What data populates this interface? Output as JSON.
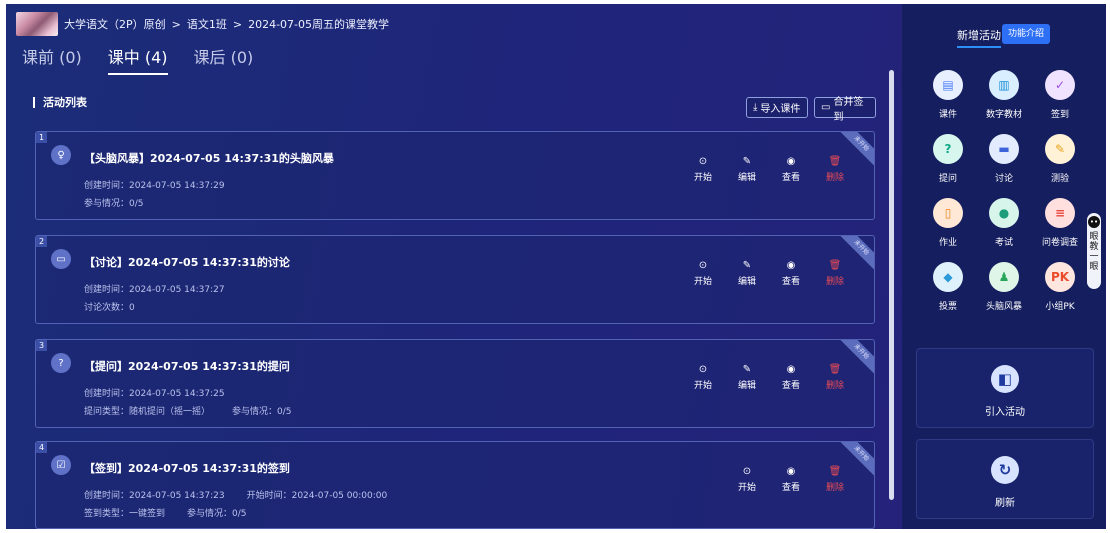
{
  "breadcrumb": {
    "course": "大学语文（2P）原创",
    "sep1": ">",
    "class": "语文1班",
    "sep2": ">",
    "lesson": "2024-07-05周五的课堂教学"
  },
  "tabs": [
    {
      "label": "课前 (0)"
    },
    {
      "label": "课中 (4)"
    },
    {
      "label": "课后 (0)"
    }
  ],
  "list_title": "活动列表",
  "toolbar": {
    "import_icon": "⤓",
    "import_label": "导入课件",
    "merge_icon": "▭",
    "merge_label": "合并签到"
  },
  "ribbon_label": "未开始",
  "actions": {
    "start": "开始",
    "edit": "编辑",
    "view": "查看",
    "delete": "删除",
    "start_icon": "⊙",
    "edit_icon": "✎",
    "view_icon": "◉",
    "delete_icon": "🗑"
  },
  "activities": [
    {
      "num": "1",
      "icon": "♀",
      "title": "【头脑风暴】2024-07-05 14:37:31的头脑风暴",
      "line1": [
        "创建时间：2024-07-05 14:37:29"
      ],
      "line2": [
        "参与情况：0/5"
      ]
    },
    {
      "num": "2",
      "icon": "▭",
      "title": "【讨论】2024-07-05 14:37:31的讨论",
      "line1": [
        "创建时间：2024-07-05 14:37:27"
      ],
      "line2": [
        "讨论次数：0"
      ]
    },
    {
      "num": "3",
      "icon": "?",
      "title": "【提问】2024-07-05 14:37:31的提问",
      "line1": [
        "创建时间：2024-07-05 14:37:25"
      ],
      "line2": [
        "提问类型：随机提问（摇一摇）",
        "参与情况：0/5"
      ]
    },
    {
      "num": "4",
      "icon": "☑",
      "title": "【签到】2024-07-05 14:37:31的签到",
      "line1": [
        "创建时间：2024-07-05 14:37:23",
        "开始时间：2024-07-05 00:00:00"
      ],
      "line2": [
        "签到类型：一键签到",
        "参与情况：0/5"
      ]
    }
  ],
  "right": {
    "new_activity": "新增活动",
    "intro": "功能介绍",
    "items": [
      {
        "label": "课件",
        "icon": "courseware-icon",
        "glyph": "▤",
        "color": "#4a7cf7",
        "bg": "#e8f0ff"
      },
      {
        "label": "数字教材",
        "icon": "digital-textbook-icon",
        "glyph": "▥",
        "color": "#1f8fd6",
        "bg": "#d9efff"
      },
      {
        "label": "签到",
        "icon": "sign-in-icon",
        "glyph": "✓",
        "color": "#9b4de0",
        "bg": "#f0e3ff"
      },
      {
        "label": "提问",
        "icon": "question-icon",
        "glyph": "?",
        "color": "#11a98a",
        "bg": "#d6f6ee"
      },
      {
        "label": "讨论",
        "icon": "discussion-icon",
        "glyph": "▬",
        "color": "#3d63d9",
        "bg": "#e3ebff"
      },
      {
        "label": "测验",
        "icon": "quiz-icon",
        "glyph": "✎",
        "color": "#e6a21c",
        "bg": "#fff2d6"
      },
      {
        "label": "作业",
        "icon": "homework-icon",
        "glyph": "▯",
        "color": "#e8821e",
        "bg": "#ffe9d6"
      },
      {
        "label": "考试",
        "icon": "exam-icon",
        "glyph": "●",
        "color": "#1d9d7a",
        "bg": "#d8f5ec"
      },
      {
        "label": "问卷调查",
        "icon": "survey-icon",
        "glyph": "≡",
        "color": "#e8473c",
        "bg": "#ffe0de"
      },
      {
        "label": "投票",
        "icon": "vote-icon",
        "glyph": "◆",
        "color": "#2b9ad8",
        "bg": "#dff1fb"
      },
      {
        "label": "头脑风暴",
        "icon": "brainstorm-icon",
        "glyph": "♟",
        "color": "#27a55a",
        "bg": "#dff5e7"
      },
      {
        "label": "小组PK",
        "icon": "group-pk-icon",
        "glyph": "PK",
        "color": "#ea4b2a",
        "bg": "#ffe6de"
      }
    ],
    "import_label": "引入活动",
    "refresh_label": "刷新",
    "import_glyph": "◧",
    "refresh_glyph": "↻"
  },
  "assistant": {
    "bot": "••",
    "text": [
      "眼",
      "教",
      "一",
      "眼"
    ]
  }
}
